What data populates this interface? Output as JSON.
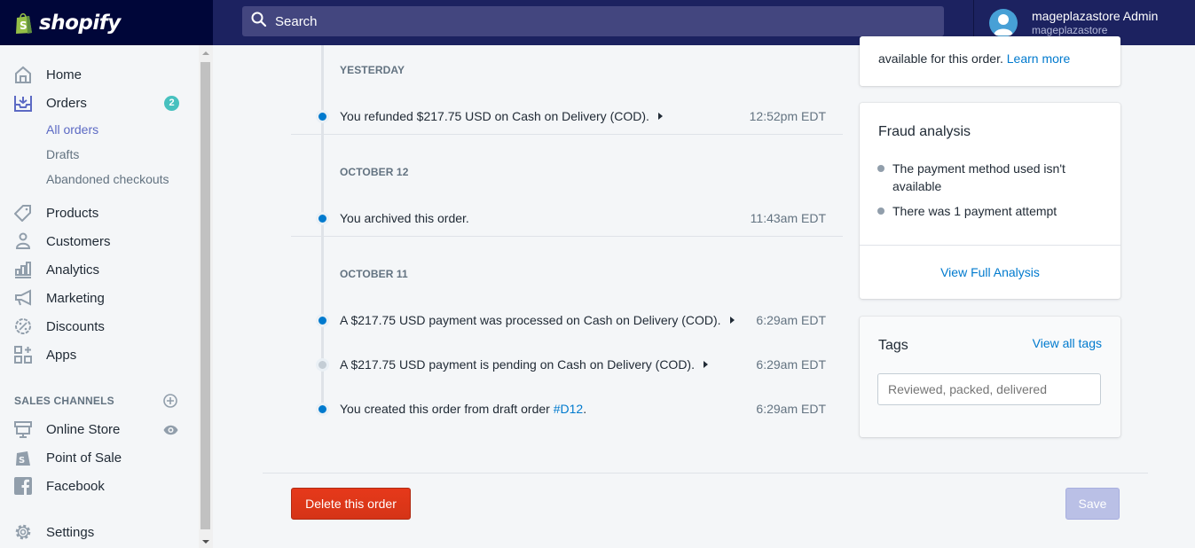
{
  "brand": {
    "name": "shopify"
  },
  "search": {
    "placeholder": "Search"
  },
  "user": {
    "name": "mageplazastore Admin",
    "store": "mageplazastore"
  },
  "sidebar": {
    "items": [
      {
        "label": "Home",
        "icon": "home-icon"
      },
      {
        "label": "Orders",
        "icon": "orders-icon",
        "badge": "2"
      },
      {
        "label": "Products",
        "icon": "tag-icon"
      },
      {
        "label": "Customers",
        "icon": "person-icon"
      },
      {
        "label": "Analytics",
        "icon": "bar-chart-icon"
      },
      {
        "label": "Marketing",
        "icon": "megaphone-icon"
      },
      {
        "label": "Discounts",
        "icon": "discount-icon"
      },
      {
        "label": "Apps",
        "icon": "apps-icon"
      }
    ],
    "orders_sub": [
      {
        "label": "All orders",
        "active": true
      },
      {
        "label": "Drafts"
      },
      {
        "label": "Abandoned checkouts"
      }
    ],
    "sales_channels": {
      "title": "SALES CHANNELS",
      "items": [
        {
          "label": "Online Store",
          "icon": "store-icon"
        },
        {
          "label": "Point of Sale",
          "icon": "pos-bag-icon"
        },
        {
          "label": "Facebook",
          "icon": "facebook-icon"
        }
      ]
    },
    "settings": {
      "label": "Settings",
      "icon": "gear-icon"
    }
  },
  "timeline": {
    "groups": [
      {
        "date": "YESTERDAY",
        "events": [
          {
            "text": "You refunded $217.75 USD on Cash on Delivery (COD).",
            "time": "12:52pm EDT",
            "expandable": true,
            "status": "complete"
          }
        ]
      },
      {
        "date": "OCTOBER 12",
        "events": [
          {
            "text": "You archived this order.",
            "time": "11:43am EDT",
            "expandable": false,
            "status": "complete"
          }
        ]
      },
      {
        "date": "OCTOBER 11",
        "events": [
          {
            "text": "A $217.75 USD payment was processed on Cash on Delivery (COD).",
            "time": "6:29am EDT",
            "expandable": true,
            "status": "complete"
          },
          {
            "text": "A $217.75 USD payment is pending on Cash on Delivery (COD).",
            "time": "6:29am EDT",
            "expandable": true,
            "status": "pending"
          },
          {
            "text_prefix": "You created this order from draft order ",
            "link": "#D12",
            "text_suffix": ".",
            "time": "6:29am EDT",
            "expandable": false,
            "status": "complete"
          }
        ]
      }
    ]
  },
  "info_card": {
    "text": "available for this order.",
    "link": "Learn more"
  },
  "fraud": {
    "title": "Fraud analysis",
    "bullets": [
      "The payment method used isn't available",
      "There was 1 payment attempt"
    ],
    "action": "View Full Analysis"
  },
  "tags": {
    "title": "Tags",
    "view_all": "View all tags",
    "placeholder": "Reviewed, packed, delivered"
  },
  "footer": {
    "delete_label": "Delete this order",
    "save_label": "Save"
  },
  "colors": {
    "accent": "#5c6ac4",
    "link": "#007ace",
    "danger": "#de3618",
    "topbar": "#1c2260",
    "badge": "#47c1bf"
  }
}
